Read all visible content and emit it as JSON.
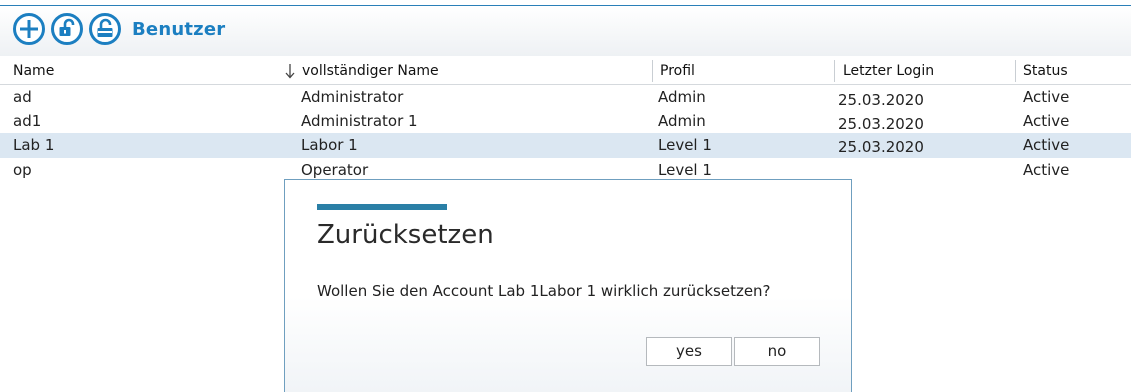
{
  "toolbar": {
    "title": "Benutzer",
    "icons": [
      "add-icon",
      "unlock-icon",
      "unlock-reset-icon"
    ],
    "accent": "#1c7fc1"
  },
  "table": {
    "columns": [
      "Name",
      "vollständiger Name",
      "Profil",
      "Letzter Login",
      "Status"
    ],
    "sort_column": "vollständiger Name",
    "rows": [
      {
        "name": "ad",
        "full_name": "Administrator",
        "profile": "Admin",
        "last_login": "25.03.2020",
        "status": "Active"
      },
      {
        "name": "ad1",
        "full_name": "Administrator 1",
        "profile": "Admin",
        "last_login": "25.03.2020",
        "status": "Active"
      },
      {
        "name": "Lab 1",
        "full_name": "Labor 1",
        "profile": "Level 1",
        "last_login": "25.03.2020",
        "status": "Active"
      },
      {
        "name": "op",
        "full_name": "Operator",
        "profile": "Level 1",
        "last_login": "",
        "status": "Active"
      }
    ],
    "selected_row": 2,
    "selection_color": "#dbe7f2"
  },
  "dialog": {
    "title": "Zurücksetzen",
    "message": "Wollen Sie den Account Lab 1Labor 1 wirklich zurücksetzen?",
    "yes_label": "yes",
    "no_label": "no",
    "accent": "#2a7fa6"
  }
}
